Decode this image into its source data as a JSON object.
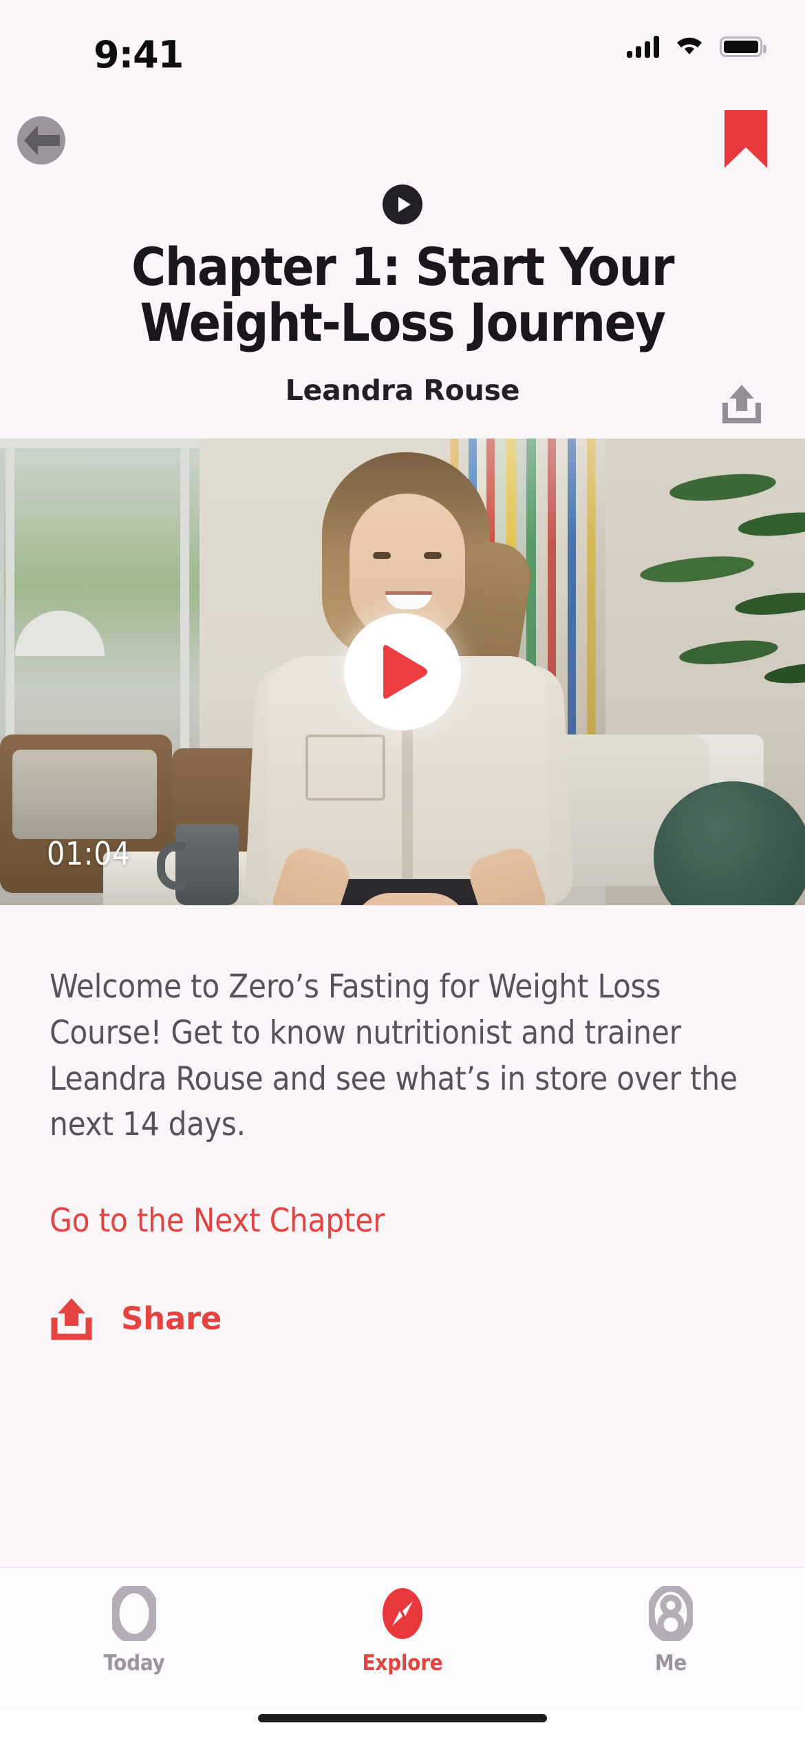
{
  "status_bar": {
    "time": "9:41",
    "cellular_icon": "cellular-signal-icon",
    "wifi_icon": "wifi-icon",
    "battery_icon": "battery-full-icon"
  },
  "nav": {
    "back_icon": "back-arrow-icon",
    "bookmark_icon": "bookmark-filled-icon",
    "bookmark_color": "#e8383c"
  },
  "header": {
    "play_badge_icon": "play-circle-icon",
    "title": "Chapter 1: Start Your Weight-Loss Journey",
    "author": "Leandra Rouse",
    "share_icon": "share-icon"
  },
  "video": {
    "duration": "01:04",
    "play_button_icon": "play-triangle-icon",
    "play_button_color": "#ef3e42"
  },
  "body": {
    "description": "Welcome to Zero’s Fasting for Weight Loss Course! Get to know nutritionist and trainer Leandra Rouse and see what’s in store over the next 14 days.",
    "next_chapter_link": "Go to the Next Chapter",
    "share_label": "Share",
    "share_icon": "share-icon",
    "accent_color": "#e5433f"
  },
  "tab_bar": {
    "tabs": [
      {
        "label": "Today",
        "icon": "today-ring-icon",
        "active": false
      },
      {
        "label": "Explore",
        "icon": "explore-compass-icon",
        "active": true
      },
      {
        "label": "Me",
        "icon": "person-icon",
        "active": false
      }
    ],
    "active_color": "#e5433f",
    "inactive_color": "#9b949e"
  }
}
